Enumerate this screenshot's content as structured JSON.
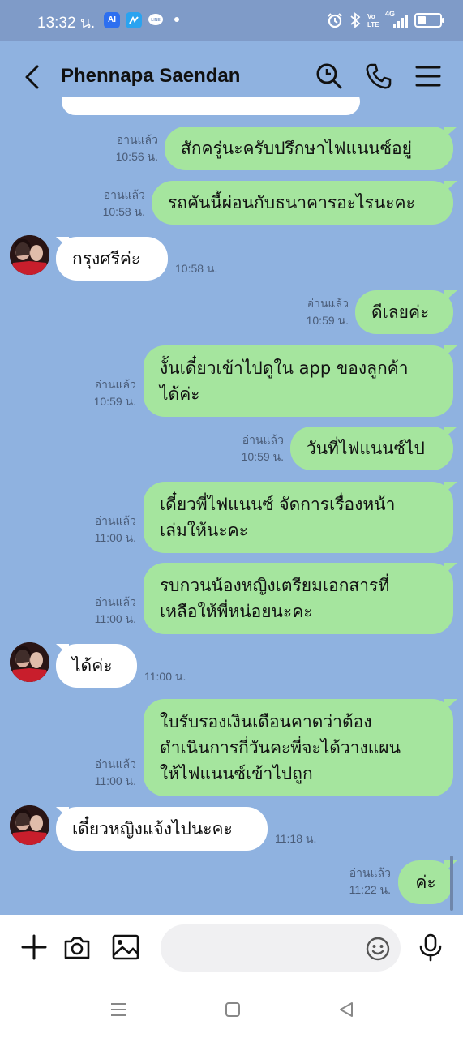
{
  "status_bar": {
    "time": "13:32 น.",
    "network": "4G",
    "app_badge": "AI",
    "line_badge": "LINE"
  },
  "header": {
    "contact_name": "Phennapa Saendan"
  },
  "messages": [
    {
      "from": "me",
      "text_lines": [
        "สักครู่นะครับปรึกษาไฟแนนซ์อยู่"
      ],
      "read": "อ่านแล้ว",
      "time": "10:56 น."
    },
    {
      "from": "me",
      "text_lines": [
        "รถคันนี้ผ่อนกับธนาคารอะไรนะคะ"
      ],
      "read": "อ่านแล้ว",
      "time": "10:58 น."
    },
    {
      "from": "them",
      "text_lines": [
        "กรุงศรีค่ะ"
      ],
      "time": "10:58 น."
    },
    {
      "from": "me",
      "text_lines": [
        "ดีเลยค่ะ"
      ],
      "read": "อ่านแล้ว",
      "time": "10:59 น."
    },
    {
      "from": "me",
      "text_lines": [
        "งั้นเดี๋ยวเข้าไปดูใน app ของลูกค้า",
        "ได้ค่ะ"
      ],
      "read": "อ่านแล้ว",
      "time": "10:59 น."
    },
    {
      "from": "me",
      "text_lines": [
        "วันที่ไฟแนนซ์ไป"
      ],
      "read": "อ่านแล้ว",
      "time": "10:59 น."
    },
    {
      "from": "me",
      "text_lines": [
        "เดี๋ยวพี่ไฟแนนซ์ จัดการเรื่องหน้า",
        "เล่มให้นะคะ"
      ],
      "read": "อ่านแล้ว",
      "time": "11:00 น."
    },
    {
      "from": "me",
      "text_lines": [
        "รบกวนน้องหญิงเตรียมเอกสารที่",
        "เหลือให้พี่หน่อยนะคะ"
      ],
      "read": "อ่านแล้ว",
      "time": "11:00 น."
    },
    {
      "from": "them",
      "text_lines": [
        "ได้ค่ะ"
      ],
      "time": "11:00 น."
    },
    {
      "from": "me",
      "text_lines": [
        "ใบรับรองเงินเดือนคาดว่าต้อง",
        "ดำเนินการกี่วันคะพี่จะได้วางแผน",
        "ให้ไฟแนนซ์เข้าไปถูก"
      ],
      "read": "อ่านแล้ว",
      "time": "11:00 น."
    },
    {
      "from": "them",
      "text_lines": [
        "เดี๋ยวหญิงแจ้งไปนะคะ"
      ],
      "time": "11:18 น."
    },
    {
      "from": "me",
      "text_lines": [
        "ค่ะ"
      ],
      "read": "อ่านแล้ว",
      "time": "11:22 น."
    }
  ],
  "input": {
    "placeholder": ""
  },
  "icons": {
    "back": "chevron-left-icon",
    "search": "search-icon",
    "call": "phone-icon",
    "menu": "hamburger-menu-icon",
    "add": "plus-icon",
    "camera": "camera-icon",
    "gallery": "image-icon",
    "emoji": "emoji-icon",
    "voice": "microphone-icon"
  },
  "colors": {
    "chat_bg": "#8fb2e0",
    "my_bubble": "#a5e59e",
    "their_bubble": "#ffffff",
    "status_bar": "#7f9bc8"
  }
}
